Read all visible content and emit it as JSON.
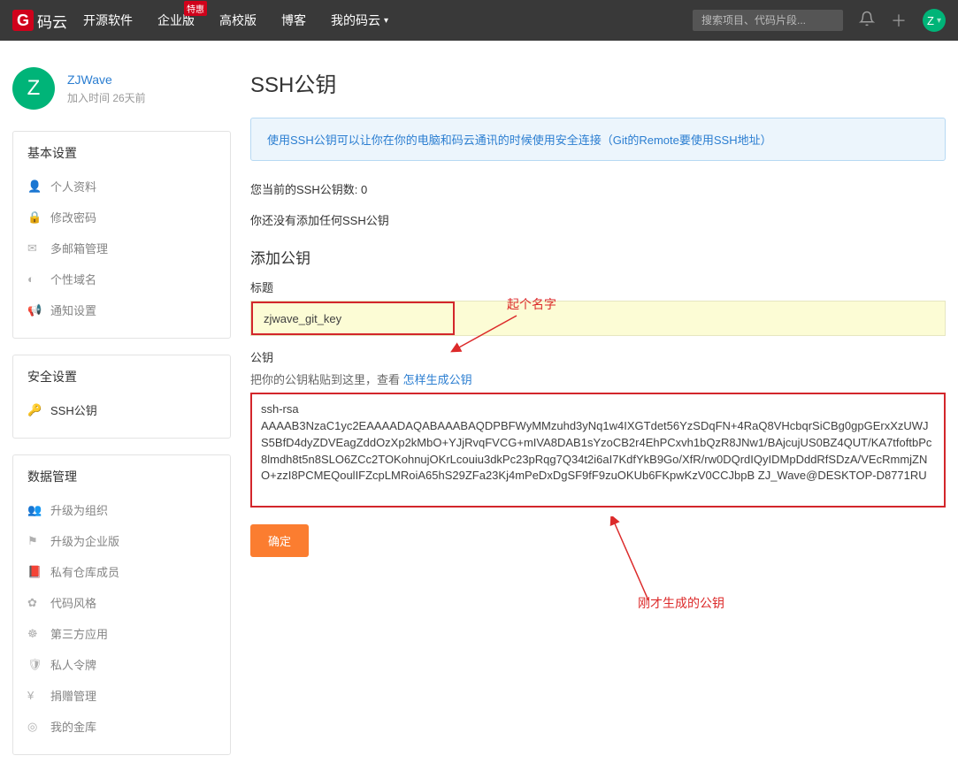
{
  "nav": {
    "logo_text": "码云",
    "items": [
      "开源软件",
      "企业版",
      "高校版",
      "博客",
      "我的码云"
    ],
    "badge": "特惠",
    "search_placeholder": "搜索项目、代码片段...",
    "avatar_letter": "Z"
  },
  "user": {
    "avatar_letter": "Z",
    "name": "ZJWave",
    "joined": "加入时间 26天前"
  },
  "sidebar": {
    "groups": [
      {
        "title": "基本设置",
        "items": [
          "个人资料",
          "修改密码",
          "多邮箱管理",
          "个性域名",
          "通知设置"
        ]
      },
      {
        "title": "安全设置",
        "items": [
          "SSH公钥"
        ]
      },
      {
        "title": "数据管理",
        "items": [
          "升级为组织",
          "升级为企业版",
          "私有仓库成员",
          "代码风格",
          "第三方应用",
          "私人令牌",
          "捐赠管理",
          "我的金库"
        ]
      }
    ]
  },
  "page": {
    "title": "SSH公钥",
    "banner": "使用SSH公钥可以让你在你的电脑和码云通讯的时候使用安全连接（Git的Remote要使用SSH地址）",
    "count_line": "您当前的SSH公钥数: 0",
    "empty_line": "你还没有添加任何SSH公钥",
    "add_section": "添加公钥",
    "title_label": "标题",
    "title_value": "zjwave_git_key",
    "key_label": "公钥",
    "key_hint_prefix": "把你的公钥粘贴到这里，查看 ",
    "key_hint_link": "怎样生成公钥",
    "key_text": "ssh-rsa AAAAB3NzaC1yc2EAAAADAQABAAABAQDPBFWyMMzuhd3yNq1w4IXGTdet56YzSDqFN+4RaQ8VHcbqrSiCBg0gpGErxXzUWJS5BfD4dyZDVEagZddOzXp2kMbO+YJjRvqFVCG+mIVA8DAB1sYzoCB2r4EhPCxvh1bQzR8JNw1/BAjcujUS0BZ4QUT/KA7tfoftbPc8lmdh8t5n8SLO6ZCc2TOKohnujOKrLcouiu3dkPc23pRqg7Q34t2i6aI7KdfYkB9Go/XfR/rw0DQrdIQyIDMpDddRfSDzA/VEcRmmjZNO+zzI8PCMEQoulIFZcpLMRoiA65hS29ZFa23Kj4mPeDxDgSF9fF9zuOKUb6FKpwKzV0CCJbpB ZJ_Wave@DESKTOP-D8771RU",
    "submit": "确定",
    "anno1": "起个名字",
    "anno2": "刚才生成的公钥"
  }
}
